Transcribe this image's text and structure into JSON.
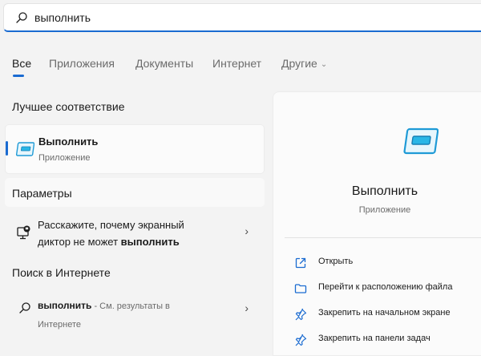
{
  "search": {
    "query": "выполнить"
  },
  "tabs": [
    {
      "label": "Все"
    },
    {
      "label": "Приложения"
    },
    {
      "label": "Документы"
    },
    {
      "label": "Интернет"
    },
    {
      "label": "Другие"
    }
  ],
  "best_match": {
    "heading": "Лучшее соответствие",
    "title": "Выполнить",
    "subtitle": "Приложение"
  },
  "settings": {
    "heading": "Параметры",
    "item_text_1": "Расскажите, почему экранный",
    "item_text_2": "диктор не может ",
    "item_text_bold": "выполнить"
  },
  "web_search": {
    "heading": "Поиск в Интернете",
    "query_bold": "выполнить",
    "suffix": " - См. результаты в",
    "line2": "Интернете"
  },
  "detail": {
    "title": "Выполнить",
    "subtitle": "Приложение",
    "actions": [
      {
        "label": "Открыть",
        "icon": "open-icon"
      },
      {
        "label": "Перейти к расположению файла",
        "icon": "folder-icon"
      },
      {
        "label": "Закрепить на начальном экране",
        "icon": "pin-icon"
      },
      {
        "label": "Закрепить на панели задач",
        "icon": "pin-icon"
      }
    ]
  },
  "colors": {
    "accent": "#1a6bd1",
    "icon_cyan": "#29b6e6"
  }
}
